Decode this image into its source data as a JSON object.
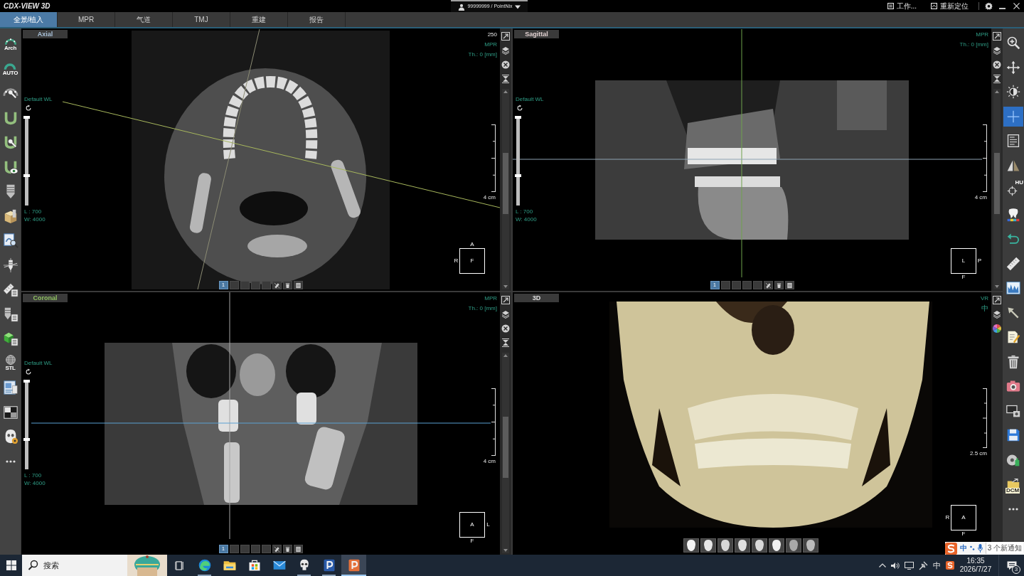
{
  "window": {
    "title": "CDX-VIEW 3D",
    "user": "99999999 / PointNix",
    "actions": [
      {
        "label": "工作..."
      },
      {
        "label": "重新定位"
      }
    ]
  },
  "tabs": [
    {
      "label": "全景/植入",
      "selected": true
    },
    {
      "label": "MPR",
      "selected": false
    },
    {
      "label": "气道",
      "selected": false
    },
    {
      "label": "TMJ",
      "selected": false
    },
    {
      "label": "重建",
      "selected": false
    },
    {
      "label": "报告",
      "selected": false
    }
  ],
  "left_toolbar": {
    "arch_label": "Arch",
    "auto_label": "AUTO",
    "stl_label": "STL"
  },
  "viewports": [
    {
      "label": "Axial",
      "kind": "axial",
      "info": [
        {
          "text": "250",
          "kind": "slice"
        },
        {
          "text": "MPR",
          "kind": "mode"
        },
        {
          "text": "Th.: 0 [mm]",
          "kind": "mode"
        }
      ],
      "window_level": {
        "preset": "Default WL",
        "l_value": "L : 700",
        "w_value": "W: 4000",
        "level": 0.33
      },
      "scale": "4 cm",
      "orientation": {
        "top": "A",
        "left": "R",
        "center": "F"
      },
      "pages": [
        {
          "label": "1",
          "selected": true
        },
        {
          "selected": false
        },
        {
          "selected": false
        },
        {
          "selected": false
        },
        {
          "selected": false
        }
      ]
    },
    {
      "label": "Sagittal",
      "kind": "sagittal",
      "info": [
        {
          "text": "MPR",
          "kind": "mode"
        },
        {
          "text": "Th.: 0 [mm]",
          "kind": "mode"
        }
      ],
      "window_level": {
        "preset": "Default WL",
        "l_value": "L : 700",
        "w_value": "W: 4000",
        "level": 0.33
      },
      "scale": "4 cm",
      "orientation": {
        "center": "L",
        "right": "P",
        "bottom": "F"
      },
      "pages": [
        {
          "label": "1",
          "selected": true
        },
        {
          "selected": false
        },
        {
          "selected": false
        },
        {
          "selected": false
        },
        {
          "selected": false
        }
      ]
    },
    {
      "label": "Coronal",
      "kind": "coronal",
      "info": [
        {
          "text": "MPR",
          "kind": "mode"
        },
        {
          "text": "Th.: 0 [mm]",
          "kind": "mode"
        }
      ],
      "window_level": {
        "preset": "Default WL",
        "l_value": "L : 700",
        "w_value": "W: 4000",
        "level": 0.33
      },
      "scale": "4 cm",
      "orientation": {
        "center": "A",
        "right": "L",
        "bottom": "F"
      },
      "pages": [
        {
          "label": "1",
          "selected": true
        },
        {
          "selected": false
        },
        {
          "selected": false
        },
        {
          "selected": false
        },
        {
          "selected": false
        }
      ]
    },
    {
      "label": "3D",
      "kind": "volume",
      "info": [
        {
          "text": "VR",
          "kind": "mode"
        },
        {
          "text": "中",
          "kind": "mode"
        }
      ],
      "scale": "2.5 cm",
      "orientation": {
        "left": "R",
        "center": "A",
        "bottom": "F"
      }
    }
  ],
  "right_toolbar": [
    {
      "selected": false
    },
    {
      "selected": false
    },
    {
      "selected": false
    },
    {
      "selected": true
    },
    {
      "selected": false
    },
    {
      "selected": false
    },
    {
      "label": "HU",
      "selected": false
    },
    {
      "selected": false
    },
    {
      "selected": false
    },
    {
      "selected": false
    },
    {
      "selected": false
    },
    {
      "selected": false
    },
    {
      "selected": false
    },
    {
      "selected": false
    },
    {
      "selected": false
    },
    {
      "selected": false
    },
    {
      "selected": false
    },
    {
      "selected": false
    },
    {
      "label": "DCM",
      "selected": false
    }
  ],
  "taskbar": {
    "search": {
      "placeholder": "搜索"
    },
    "apps": [
      {
        "running": true,
        "selected": false
      },
      {
        "running": false,
        "selected": false
      },
      {
        "running": false,
        "selected": false
      },
      {
        "running": false,
        "selected": false
      },
      {
        "running": true,
        "selected": false
      },
      {
        "running": true,
        "selected": false
      },
      {
        "running": true,
        "selected": true
      }
    ],
    "tray": {
      "ime": "中",
      "time": "16:35",
      "date": "2026/7/27",
      "notifications": "3"
    }
  },
  "ime_bar": {
    "mode": "中",
    "notice": "3 个新通知"
  }
}
